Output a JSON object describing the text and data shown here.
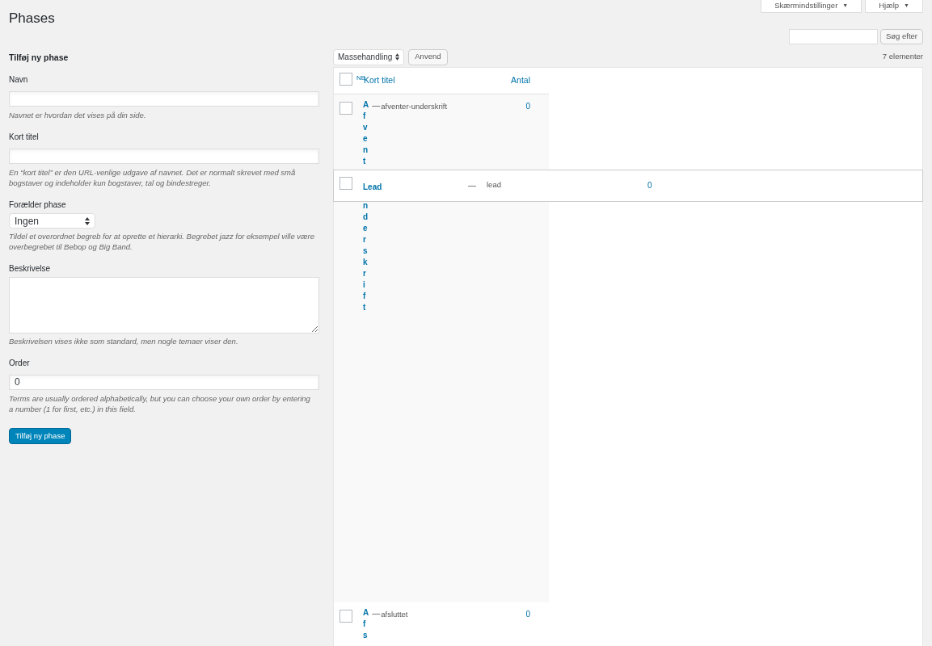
{
  "title": "Phases",
  "top_buttons": [
    {
      "label": "Skærmindstillinger",
      "caret": "▼"
    },
    {
      "label": "Hjælp",
      "caret": "▼"
    }
  ],
  "search": {
    "button": "Søg efter"
  },
  "form": {
    "heading": "Tilføj ny phase",
    "fields": [
      {
        "kind": "text",
        "label": "Navn",
        "help": "Navnet er hvordan det vises på din side."
      },
      {
        "kind": "text",
        "label": "Kort titel",
        "help": "En “kort titel” er den URL-venlige udgave af navnet. Det er normalt skrevet med små bogstaver og indeholder kun bogstaver, tal og bindestreger."
      },
      {
        "kind": "select",
        "label": "Forælder phase",
        "value": "Ingen",
        "help": "Tildel et overordnet begreb for at oprette et hierarki. Begrebet jazz for eksempel ville være overbegrebet til Bebop og Big Band."
      },
      {
        "kind": "textarea",
        "label": "Beskrivelse",
        "help": "Beskrivelsen vises ikke som standard, men nogle temaer viser den."
      },
      {
        "kind": "text",
        "label": "Order",
        "value": "0",
        "help": "Terms are usually ordered alphabetically, but you can choose your own order by entering a number (1 for first, etc.) in this field."
      }
    ],
    "submit": "Tilføj ny phase"
  },
  "bulk": {
    "select": "Massehandling",
    "apply": "Anvend",
    "count": "7 elementer"
  },
  "table": {
    "header_checked": false,
    "columns": [
      {
        "label": "NB"
      },
      {
        "label": "Kort titel"
      },
      {
        "label": "Antal"
      }
    ],
    "rows": [
      {
        "kind": "stacked",
        "checked": false,
        "name": "Afvent",
        "name_continued": "nderskrift",
        "dash": "—",
        "slug": "afventer-underskrift",
        "count": "0"
      },
      {
        "kind": "overlay",
        "checked": false,
        "name": "Lead",
        "dash": "—",
        "slug": "lead",
        "count": "0"
      },
      {
        "kind": "stacked",
        "checked": false,
        "name": "Afs",
        "dash": "—",
        "slug": "afsluttet",
        "count": "0"
      }
    ]
  }
}
